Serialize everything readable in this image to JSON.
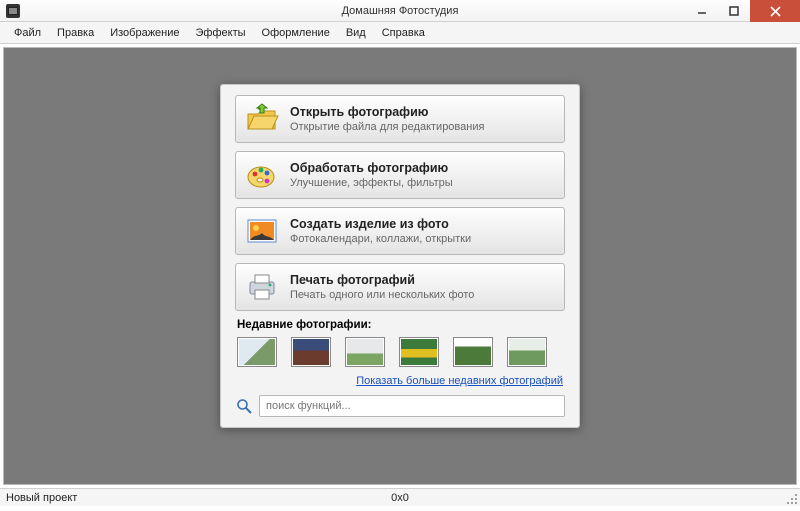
{
  "window": {
    "title": "Домашняя Фотостудия"
  },
  "menu": {
    "file": "Файл",
    "edit": "Правка",
    "image": "Изображение",
    "effects": "Эффекты",
    "decor": "Оформление",
    "view": "Вид",
    "help": "Справка"
  },
  "actions": {
    "open": {
      "title": "Открыть фотографию",
      "subtitle": "Открытие файла для редактирования"
    },
    "process": {
      "title": "Обработать фотографию",
      "subtitle": "Улучшение, эффекты, фильтры"
    },
    "create": {
      "title": "Создать изделие из фото",
      "subtitle": "Фотокалендари, коллажи, открытки"
    },
    "print": {
      "title": "Печать фотографий",
      "subtitle": "Печать одного или нескольких фото"
    }
  },
  "recent": {
    "label": "Недавние фотографии:",
    "more_link": "Показать больше недавних фотографий"
  },
  "search": {
    "placeholder": "поиск функций..."
  },
  "status": {
    "project": "Новый проект",
    "dims": "0x0"
  }
}
